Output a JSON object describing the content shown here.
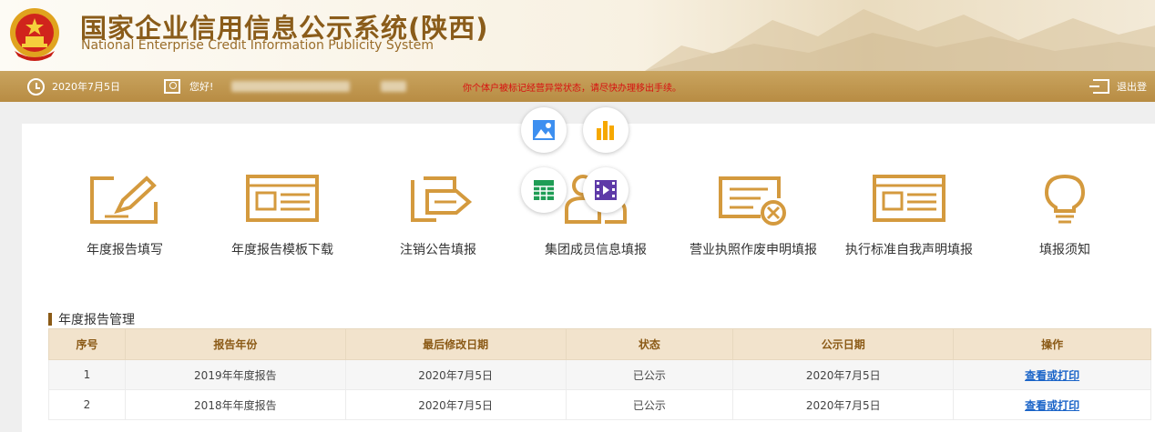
{
  "header": {
    "title_cn": "国家企业信用信息公示系统(陕西)",
    "title_en": "National Enterprise Credit Information Publicity System",
    "emblem_icon": "national-emblem-icon"
  },
  "statusbar": {
    "date": "2020年7月5日",
    "greeting": "您好!",
    "warning": "你个体户被标记经营异常状态，请尽快办理移出手续。",
    "logout": "退出登",
    "colors": {
      "bar": "#b88c43",
      "warning": "#d80f0f"
    }
  },
  "functions": [
    {
      "label": "年度报告填写",
      "icon": "edit-icon"
    },
    {
      "label": "年度报告模板下载",
      "icon": "template-icon"
    },
    {
      "label": "注销公告填报",
      "icon": "cancel-notice-icon"
    },
    {
      "label": "集团成员信息填报",
      "icon": "group-members-icon"
    },
    {
      "label": "营业执照作废申明填报",
      "icon": "license-void-icon"
    },
    {
      "label": "执行标准自我声明填报",
      "icon": "standard-declaration-icon"
    },
    {
      "label": "填报须知",
      "icon": "lightbulb-icon"
    }
  ],
  "floating_buttons": [
    "image-icon",
    "bar-chart-icon",
    "spreadsheet-icon",
    "video-icon"
  ],
  "section": {
    "title": "年度报告管理"
  },
  "table": {
    "headers": [
      "序号",
      "报告年份",
      "最后修改日期",
      "状态",
      "公示日期",
      "操作"
    ],
    "rows": [
      {
        "no": "1",
        "year": "2019年年度报告",
        "modified": "2020年7月5日",
        "status": "已公示",
        "published": "2020年7月5日",
        "action": "查看或打印"
      },
      {
        "no": "2",
        "year": "2018年年度报告",
        "modified": "2020年7月5日",
        "status": "已公示",
        "published": "2020年7月5日",
        "action": "查看或打印"
      }
    ]
  },
  "theme": {
    "accent": "#b88c43",
    "title_color": "#8a5c1a",
    "link_color": "#1a64c8"
  }
}
